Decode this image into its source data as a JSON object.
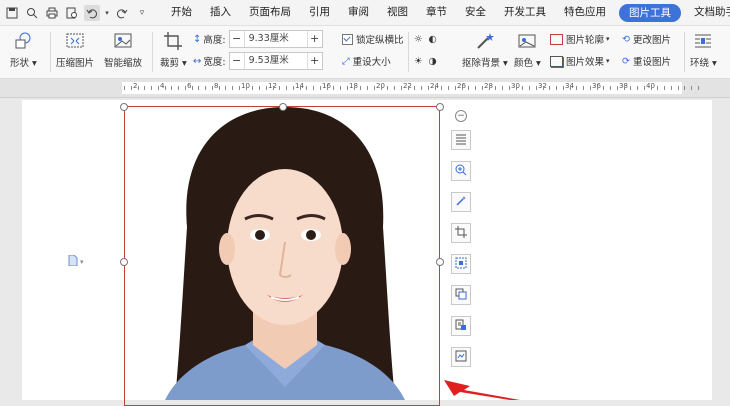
{
  "menubar": {
    "tabs": [
      "开始",
      "插入",
      "页面布局",
      "引用",
      "审阅",
      "视图",
      "章节",
      "安全",
      "开发工具",
      "特色应用",
      "图片工具",
      "文档助手"
    ],
    "active_tab": "图片工具"
  },
  "ribbon": {
    "shape": "形状",
    "compress": "压缩图片",
    "smart_zoom": "智能缩放",
    "crop": "裁剪",
    "height_label": "高度:",
    "height_value": "9.33厘米",
    "width_label": "宽度:",
    "width_value": "9.53厘米",
    "lock_ratio": "锁定纵横比",
    "reset_size": "重设大小",
    "remove_bg": "抠除背景",
    "color": "颜色",
    "picture_outline": "图片轮廓",
    "picture_effect": "图片效果",
    "change_picture": "更改图片",
    "reset_picture": "重设图片",
    "wrap": "环绕"
  },
  "ruler": {
    "labels": [
      "2",
      "4",
      "6",
      "8",
      "10",
      "12",
      "14",
      "16",
      "18",
      "20",
      "22",
      "24",
      "26",
      "28",
      "30",
      "32",
      "34",
      "36",
      "38",
      "40"
    ]
  },
  "colors": {
    "accent": "#3c72d9",
    "selection_border": "#c04040",
    "photo_background": "#ffffff",
    "hair": "#2a1a14",
    "shirt": "#7d9ccc"
  }
}
